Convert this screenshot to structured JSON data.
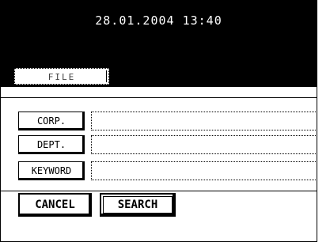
{
  "header": {
    "datetime": "28.01.2004 13:40"
  },
  "tabs": [
    {
      "label": "FILE"
    }
  ],
  "fields": [
    {
      "label": "CORP.",
      "value": ""
    },
    {
      "label": "DEPT.",
      "value": ""
    },
    {
      "label": "KEYWORD",
      "value": ""
    }
  ],
  "actions": {
    "cancel_label": "CANCEL",
    "search_label": "SEARCH"
  }
}
